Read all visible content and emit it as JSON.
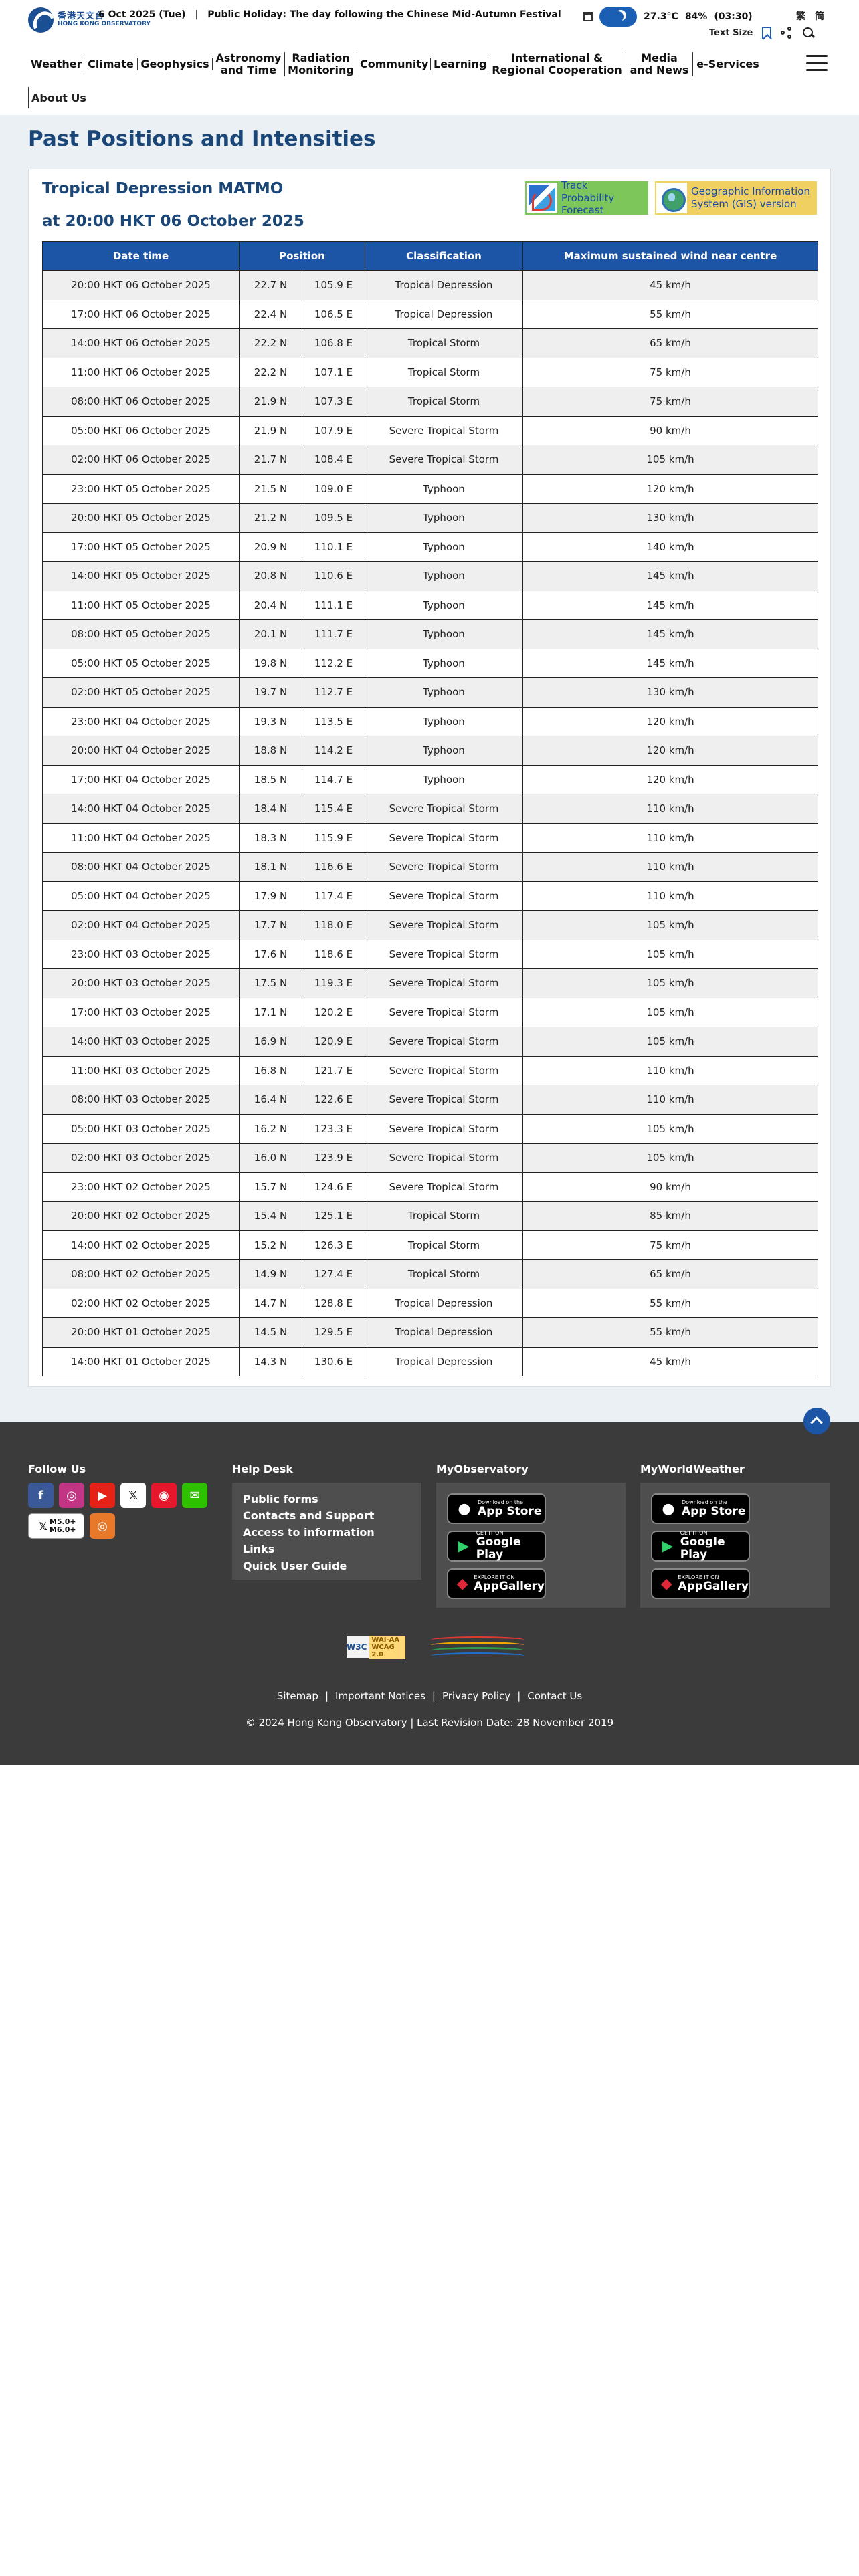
{
  "header": {
    "logo_zh": "香港天文台",
    "logo_en": "HONG KONG OBSERVATORY",
    "date": "6 Oct 2025 (Tue)",
    "separator": "|",
    "holiday_label": "Public Holiday:",
    "holiday_name": "The day following the Chinese Mid-Autumn Festival",
    "temperature": "27.3°C",
    "humidity": "84%",
    "time": "(03:30)",
    "lang_trad": "繁",
    "lang_simp": "简",
    "text_size": "Text Size"
  },
  "nav": {
    "items": [
      "Weather",
      "Climate",
      "Geophysics",
      "Astronomy and Time",
      "Radiation Monitoring",
      "Community",
      "Learning",
      "International & Regional Cooperation",
      "Media and News",
      "e-Services"
    ],
    "about": "About Us"
  },
  "page": {
    "title": "Past Positions and Intensities",
    "storm_name": "Tropical Depression MATMO",
    "storm_time": "at 20:00 HKT 06 October 2025",
    "track_button": "Track Probability Forecast",
    "gis_button": "Geographic Information System (GIS) version"
  },
  "table": {
    "headers": [
      "Date time",
      "Position",
      "Classification",
      "Maximum sustained wind near centre"
    ],
    "rows": [
      [
        "20:00 HKT 06 October 2025",
        "22.7 N",
        "105.9 E",
        "Tropical Depression",
        "45 km/h"
      ],
      [
        "17:00 HKT 06 October 2025",
        "22.4 N",
        "106.5 E",
        "Tropical Depression",
        "55 km/h"
      ],
      [
        "14:00 HKT 06 October 2025",
        "22.2 N",
        "106.8 E",
        "Tropical Storm",
        "65 km/h"
      ],
      [
        "11:00 HKT 06 October 2025",
        "22.2 N",
        "107.1 E",
        "Tropical Storm",
        "75 km/h"
      ],
      [
        "08:00 HKT 06 October 2025",
        "21.9 N",
        "107.3 E",
        "Tropical Storm",
        "75 km/h"
      ],
      [
        "05:00 HKT 06 October 2025",
        "21.9 N",
        "107.9 E",
        "Severe Tropical Storm",
        "90 km/h"
      ],
      [
        "02:00 HKT 06 October 2025",
        "21.7 N",
        "108.4 E",
        "Severe Tropical Storm",
        "105 km/h"
      ],
      [
        "23:00 HKT 05 October 2025",
        "21.5 N",
        "109.0 E",
        "Typhoon",
        "120 km/h"
      ],
      [
        "20:00 HKT 05 October 2025",
        "21.2 N",
        "109.5 E",
        "Typhoon",
        "130 km/h"
      ],
      [
        "17:00 HKT 05 October 2025",
        "20.9 N",
        "110.1 E",
        "Typhoon",
        "140 km/h"
      ],
      [
        "14:00 HKT 05 October 2025",
        "20.8 N",
        "110.6 E",
        "Typhoon",
        "145 km/h"
      ],
      [
        "11:00 HKT 05 October 2025",
        "20.4 N",
        "111.1 E",
        "Typhoon",
        "145 km/h"
      ],
      [
        "08:00 HKT 05 October 2025",
        "20.1 N",
        "111.7 E",
        "Typhoon",
        "145 km/h"
      ],
      [
        "05:00 HKT 05 October 2025",
        "19.8 N",
        "112.2 E",
        "Typhoon",
        "145 km/h"
      ],
      [
        "02:00 HKT 05 October 2025",
        "19.7 N",
        "112.7 E",
        "Typhoon",
        "130 km/h"
      ],
      [
        "23:00 HKT 04 October 2025",
        "19.3 N",
        "113.5 E",
        "Typhoon",
        "120 km/h"
      ],
      [
        "20:00 HKT 04 October 2025",
        "18.8 N",
        "114.2 E",
        "Typhoon",
        "120 km/h"
      ],
      [
        "17:00 HKT 04 October 2025",
        "18.5 N",
        "114.7 E",
        "Typhoon",
        "120 km/h"
      ],
      [
        "14:00 HKT 04 October 2025",
        "18.4 N",
        "115.4 E",
        "Severe Tropical Storm",
        "110 km/h"
      ],
      [
        "11:00 HKT 04 October 2025",
        "18.3 N",
        "115.9 E",
        "Severe Tropical Storm",
        "110 km/h"
      ],
      [
        "08:00 HKT 04 October 2025",
        "18.1 N",
        "116.6 E",
        "Severe Tropical Storm",
        "110 km/h"
      ],
      [
        "05:00 HKT 04 October 2025",
        "17.9 N",
        "117.4 E",
        "Severe Tropical Storm",
        "110 km/h"
      ],
      [
        "02:00 HKT 04 October 2025",
        "17.7 N",
        "118.0 E",
        "Severe Tropical Storm",
        "105 km/h"
      ],
      [
        "23:00 HKT 03 October 2025",
        "17.6 N",
        "118.6 E",
        "Severe Tropical Storm",
        "105 km/h"
      ],
      [
        "20:00 HKT 03 October 2025",
        "17.5 N",
        "119.3 E",
        "Severe Tropical Storm",
        "105 km/h"
      ],
      [
        "17:00 HKT 03 October 2025",
        "17.1 N",
        "120.2 E",
        "Severe Tropical Storm",
        "105 km/h"
      ],
      [
        "14:00 HKT 03 October 2025",
        "16.9 N",
        "120.9 E",
        "Severe Tropical Storm",
        "105 km/h"
      ],
      [
        "11:00 HKT 03 October 2025",
        "16.8 N",
        "121.7 E",
        "Severe Tropical Storm",
        "110 km/h"
      ],
      [
        "08:00 HKT 03 October 2025",
        "16.4 N",
        "122.6 E",
        "Severe Tropical Storm",
        "110 km/h"
      ],
      [
        "05:00 HKT 03 October 2025",
        "16.2 N",
        "123.3 E",
        "Severe Tropical Storm",
        "105 km/h"
      ],
      [
        "02:00 HKT 03 October 2025",
        "16.0 N",
        "123.9 E",
        "Severe Tropical Storm",
        "105 km/h"
      ],
      [
        "23:00 HKT 02 October 2025",
        "15.7 N",
        "124.6 E",
        "Severe Tropical Storm",
        "90 km/h"
      ],
      [
        "20:00 HKT 02 October 2025",
        "15.4 N",
        "125.1 E",
        "Tropical Storm",
        "85 km/h"
      ],
      [
        "14:00 HKT 02 October 2025",
        "15.2 N",
        "126.3 E",
        "Tropical Storm",
        "75 km/h"
      ],
      [
        "08:00 HKT 02 October 2025",
        "14.9 N",
        "127.4 E",
        "Tropical Storm",
        "65 km/h"
      ],
      [
        "02:00 HKT 02 October 2025",
        "14.7 N",
        "128.8 E",
        "Tropical Depression",
        "55 km/h"
      ],
      [
        "20:00 HKT 01 October 2025",
        "14.5 N",
        "129.5 E",
        "Tropical Depression",
        "55 km/h"
      ],
      [
        "14:00 HKT 01 October 2025",
        "14.3 N",
        "130.6 E",
        "Tropical Depression",
        "45 km/h"
      ]
    ]
  },
  "footer": {
    "follow_us": "Follow Us",
    "social": [
      {
        "name": "facebook-icon",
        "glyph": "f",
        "color": "#3b5998"
      },
      {
        "name": "instagram-icon",
        "glyph": "◎",
        "color": "#c13584"
      },
      {
        "name": "youtube-icon",
        "glyph": "▶",
        "color": "#e62117"
      },
      {
        "name": "x-icon",
        "glyph": "𝕏",
        "color": "#ffffff"
      },
      {
        "name": "weibo-icon",
        "glyph": "◉",
        "color": "#e6162d"
      },
      {
        "name": "wechat-icon",
        "glyph": "✉",
        "color": "#2dc100"
      }
    ],
    "x_sub_label": "M5.0+ M6.0+",
    "help_desk": "Help Desk",
    "help_links": [
      "Public forms",
      "Contacts and Support",
      "Access to information",
      "Links",
      "Quick User Guide"
    ],
    "my_observatory": "MyObservatory",
    "my_world_weather": "MyWorldWeather",
    "stores": [
      {
        "small": "Download on the",
        "big": "App Store",
        "glyph": ""
      },
      {
        "small": "GET IT ON",
        "big": "Google Play",
        "glyph": "▶"
      },
      {
        "small": "EXPLORE IT ON",
        "big": "AppGallery",
        "glyph": "◆"
      }
    ],
    "wcag": "WAI-AA WCAG 2.0",
    "w3c": "W3C",
    "links": [
      "Sitemap",
      "Important Notices",
      "Privacy Policy",
      "Contact Us"
    ],
    "copyright": "© 2024 Hong Kong Observatory  |  Last Revision Date: 28 November 2019"
  },
  "colors": {
    "primary_blue": "#1d55a6",
    "title_blue": "#1a4778",
    "track_green": "#7dc65a",
    "gis_yellow": "#f0d060",
    "footer_dark": "#3b3b3b"
  }
}
